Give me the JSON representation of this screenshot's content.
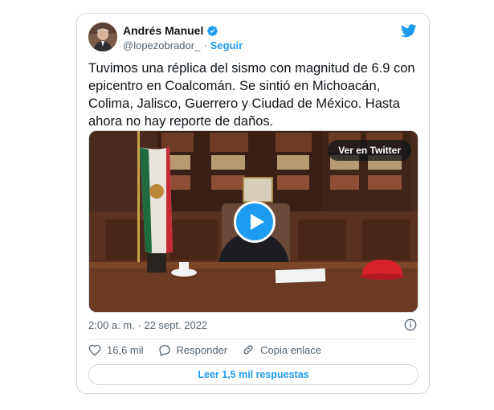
{
  "author": {
    "name": "Andrés Manuel",
    "handle": "@lopezobrador_",
    "separator": "·",
    "follow_label": "Seguir"
  },
  "tweet": {
    "text": "Tuvimos una réplica del sismo con magnitud de 6.9 con epicentro en Coalcomán. Se sintió en Michoacán, Colima, Jalisco, Guerrero y Ciudad de México. Hasta ahora no hay reporte de daños.",
    "timestamp": "2:00 a. m. · 22 sept. 2022"
  },
  "media": {
    "watch_label": "Ver en Twitter"
  },
  "actions": {
    "likes": "16,6 mil",
    "reply_label": "Responder",
    "copy_label": "Copia enlace"
  },
  "replies_button": "Leer 1,5 mil respuestas",
  "colors": {
    "accent": "#1d9bf0",
    "like_outline": "#536471"
  }
}
